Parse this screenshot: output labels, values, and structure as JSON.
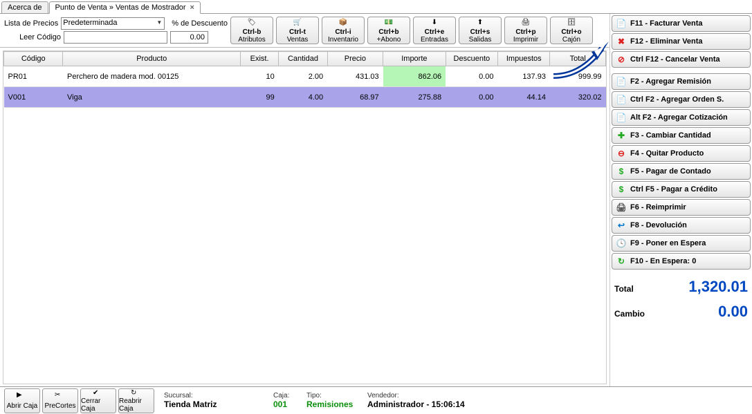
{
  "tabs": [
    {
      "label": "Acerca de",
      "active": false,
      "closable": false
    },
    {
      "label": "Punto de Venta » Ventas de Mostrador",
      "active": true,
      "closable": true
    }
  ],
  "controls": {
    "price_list_label": "Lista de Precios",
    "price_list_value": "Predeterminada",
    "discount_label": "% de Descuento",
    "discount_value": "0.00",
    "read_code_label": "Leer Código",
    "read_code_value": ""
  },
  "toolbar": [
    {
      "shortcut": "Ctrl-b",
      "label": "Atributos",
      "icon": "tag"
    },
    {
      "shortcut": "Ctrl-t",
      "label": "Ventas",
      "icon": "cart"
    },
    {
      "shortcut": "Ctrl-i",
      "label": "Inventario",
      "icon": "box"
    },
    {
      "shortcut": "Ctrl+b",
      "label": "+Abono",
      "icon": "money"
    },
    {
      "shortcut": "Ctrl+e",
      "label": "Entradas",
      "icon": "in"
    },
    {
      "shortcut": "Ctrl+s",
      "label": "Salidas",
      "icon": "out"
    },
    {
      "shortcut": "Ctrl+p",
      "label": "Imprimir",
      "icon": "print"
    },
    {
      "shortcut": "Ctrl+o",
      "label": "Cajón",
      "icon": "drawer"
    }
  ],
  "table": {
    "headers": [
      "Código",
      "Producto",
      "Exist.",
      "Cantidad",
      "Precio",
      "Importe",
      "Descuento",
      "Impuestos",
      "Total"
    ],
    "rows": [
      {
        "codigo": "PR01",
        "producto": "Perchero de madera mod. 00125",
        "exist": "10",
        "cantidad": "2.00",
        "precio": "431.03",
        "importe": "862.06",
        "descuento": "0.00",
        "impuestos": "137.93",
        "total": "999.99",
        "importe_hl": true
      },
      {
        "codigo": "V001",
        "producto": "Viga",
        "exist": "99",
        "cantidad": "4.00",
        "precio": "68.97",
        "importe": "275.88",
        "descuento": "0.00",
        "impuestos": "44.14",
        "total": "320.02",
        "importe_hl": false
      }
    ]
  },
  "right_buttons": [
    {
      "label": "F11 - Facturar Venta",
      "icon": "doc",
      "cls": "ic-orange"
    },
    {
      "label": "F12 - Eliminar Venta",
      "icon": "x",
      "cls": "ic-red"
    },
    {
      "label": "Ctrl F12 - Cancelar Venta",
      "icon": "cancel",
      "cls": "ic-red"
    }
  ],
  "right_buttons2": [
    {
      "label": "F2 - Agregar Remisión",
      "icon": "doc",
      "cls": "ic-teal"
    },
    {
      "label": "Ctrl F2 - Agregar Orden S.",
      "icon": "doc",
      "cls": "ic-teal"
    },
    {
      "label": "Alt F2 - Agregar Cotización",
      "icon": "doc",
      "cls": "ic-teal"
    },
    {
      "label": "F3 - Cambiar Cantidad",
      "icon": "plus",
      "cls": "ic-green"
    },
    {
      "label": "F4 - Quitar Producto",
      "icon": "minus",
      "cls": "ic-red"
    },
    {
      "label": "F5 - Pagar de Contado",
      "icon": "dollar",
      "cls": "ic-green"
    },
    {
      "label": "Ctrl F5 - Pagar a Crédito",
      "icon": "dollar",
      "cls": "ic-green"
    },
    {
      "label": "F6 - Reimprimir",
      "icon": "print",
      "cls": "ic-gray"
    },
    {
      "label": "F8 - Devolución",
      "icon": "back",
      "cls": "ic-blue"
    },
    {
      "label": "F9 - Poner en Espera",
      "icon": "clock",
      "cls": "ic-blue"
    },
    {
      "label": "F10 - En Espera: 0",
      "icon": "refresh",
      "cls": "ic-green"
    }
  ],
  "totals": {
    "total_label": "Total",
    "total_value": "1,320.01",
    "change_label": "Cambio",
    "change_value": "0.00"
  },
  "statusbar": {
    "buttons": [
      {
        "label": "Abrir Caja",
        "icon": "open"
      },
      {
        "label": "PreCortes",
        "icon": "cut"
      },
      {
        "label": "Cerrar Caja",
        "icon": "ok"
      },
      {
        "label": "Reabrir Caja",
        "icon": "redo"
      }
    ],
    "sucursal_label": "Sucursal:",
    "sucursal_value": "Tienda Matriz",
    "caja_label": "Caja:",
    "caja_value": "001",
    "tipo_label": "Tipo:",
    "tipo_value": "Remisiones",
    "vendedor_label": "Vendedor:",
    "vendedor_value": "Administrador - 15:06:14"
  }
}
